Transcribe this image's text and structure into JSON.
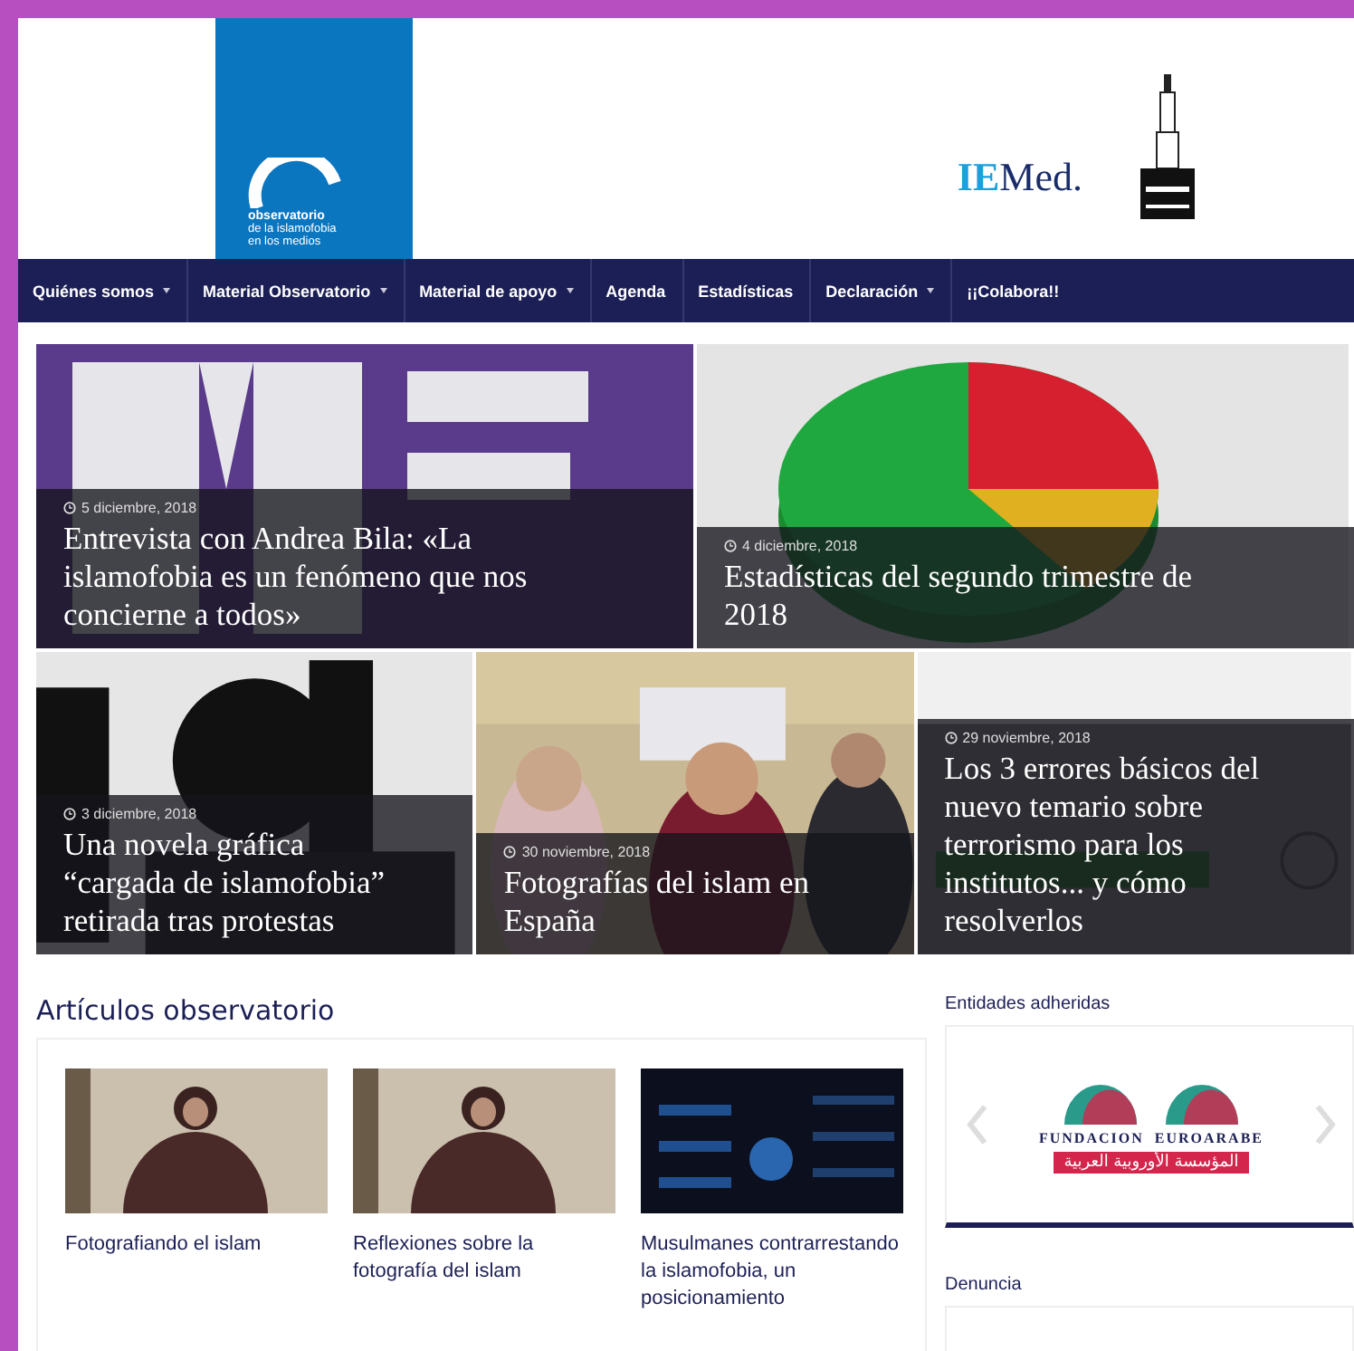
{
  "header": {
    "logo_lines": [
      "observatorio",
      "de la islamofobia",
      "en los medios"
    ],
    "partner_logo": "IEMed."
  },
  "nav": [
    {
      "label": "Quiénes somos",
      "dropdown": true
    },
    {
      "label": "Material Observatorio",
      "dropdown": true
    },
    {
      "label": "Material de apoyo",
      "dropdown": true
    },
    {
      "label": "Agenda",
      "dropdown": false
    },
    {
      "label": "Estadísticas",
      "dropdown": false
    },
    {
      "label": "Declaración",
      "dropdown": true
    },
    {
      "label": "¡¡Colabora!!",
      "dropdown": false
    }
  ],
  "featured": {
    "rows": [
      [
        {
          "date": "5 diciembre, 2018",
          "title": "Entrevista con Andrea Bila: «La islamofobia es un fenómeno que nos concierne a todos»"
        },
        {
          "date": "4 diciembre, 2018",
          "title": "Estadísticas del segundo trimestre de 2018"
        }
      ],
      [
        {
          "date": "3 diciembre, 2018",
          "title": "Una novela gráfica “cargada de islamofobia” retirada tras protestas"
        },
        {
          "date": "30 noviembre, 2018",
          "title": "Fotografías del islam en España"
        },
        {
          "date": "29 noviembre, 2018",
          "title": "Los 3 errores básicos del nuevo temario sobre terrorismo para los institutos... y cómo resolverlos"
        }
      ]
    ]
  },
  "articles": {
    "title": "Artículos observatorio",
    "items": [
      {
        "title": "Fotografiando el islam"
      },
      {
        "title": "Reflexiones sobre la fotografía del islam"
      },
      {
        "title": "Musulmanes contrarrestando la islamofobia, un posicionamiento"
      }
    ]
  },
  "sidebar": {
    "sections": [
      {
        "title": "Entidades adheridas",
        "kind": "carousel",
        "logo_name": "FUNDACION  EUROARABE",
        "logo_arabic": "المؤسسة الأوروبية العربية"
      },
      {
        "title": "Denuncia",
        "kind": "box"
      }
    ]
  }
}
